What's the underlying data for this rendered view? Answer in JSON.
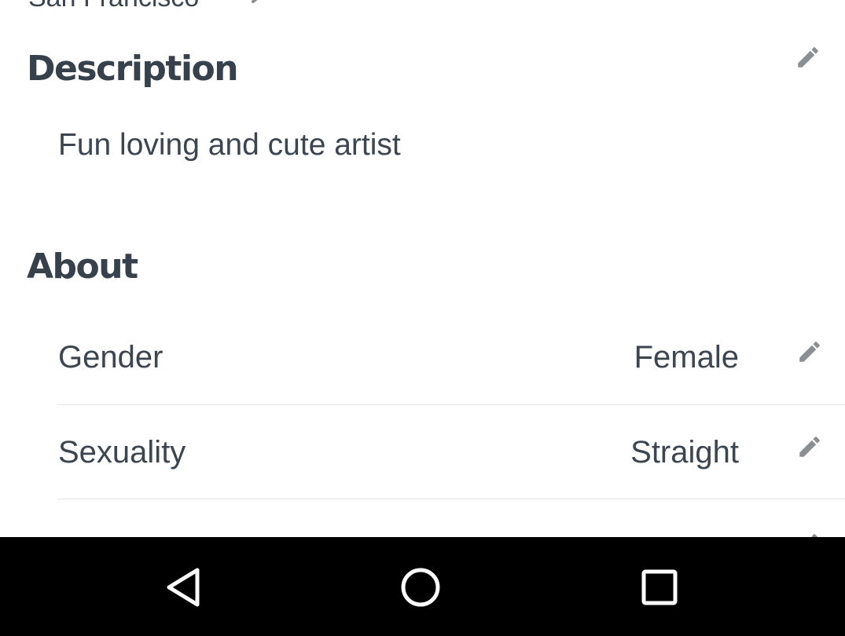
{
  "location": {
    "value": "San Francisco",
    "icon": "pencil-icon"
  },
  "description": {
    "title": "Description",
    "text": "Fun loving and cute artist",
    "edit_icon": "pencil-icon"
  },
  "about": {
    "title": "About",
    "rows": [
      {
        "label": "Gender",
        "value": "Female",
        "edit_icon": "pencil-icon"
      },
      {
        "label": "Sexuality",
        "value": "Straight",
        "edit_icon": "pencil-icon"
      }
    ]
  },
  "navbar": {
    "back_icon": "back-triangle-icon",
    "home_icon": "home-circle-icon",
    "recents_icon": "recents-square-icon"
  },
  "colors": {
    "text": "#3b4650",
    "icon": "#8a8f94",
    "divider": "#e4e7ea",
    "navbar": "#000000"
  }
}
